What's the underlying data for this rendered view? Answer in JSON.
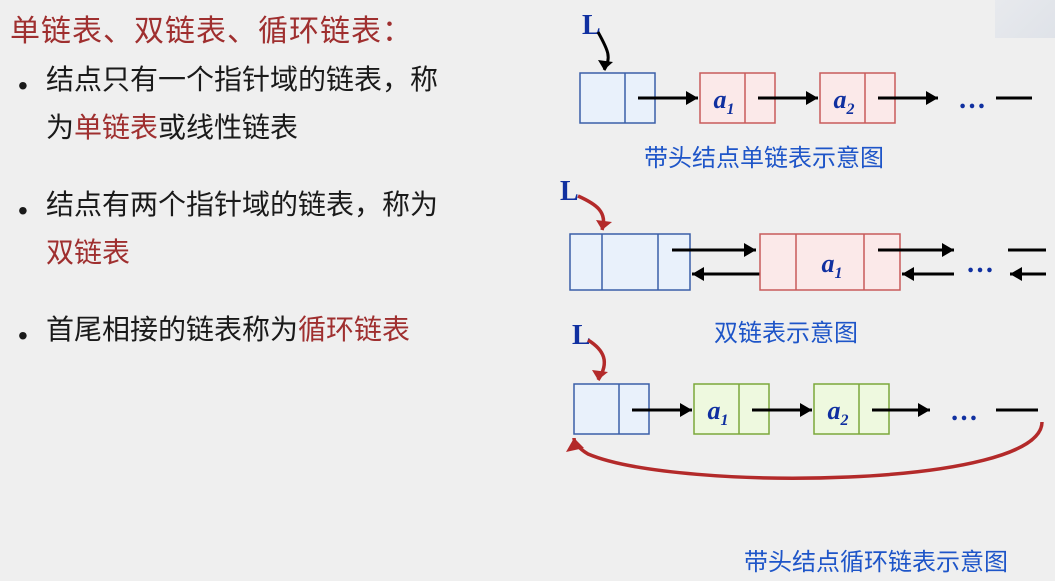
{
  "heading": "单链表、双链表、循环链表：",
  "bullets": {
    "b1a": "结点只有一个指针域的链表，称",
    "b1b": "为",
    "b1red": "单链表",
    "b1c": "或线性链表",
    "b2a": "结点有两个指针域的链表，称为",
    "b2red": "双链表",
    "b3a": "首尾相接的链表称为",
    "b3red": "循环链表"
  },
  "labels": {
    "L": "L",
    "a1": "a",
    "a1sub": "1",
    "a2": "a",
    "a2sub": "2",
    "ell": "…"
  },
  "captions": {
    "c1": "带头结点单链表示意图",
    "c2": "双链表示意图",
    "c3": "带头结点循环链表示意图"
  }
}
